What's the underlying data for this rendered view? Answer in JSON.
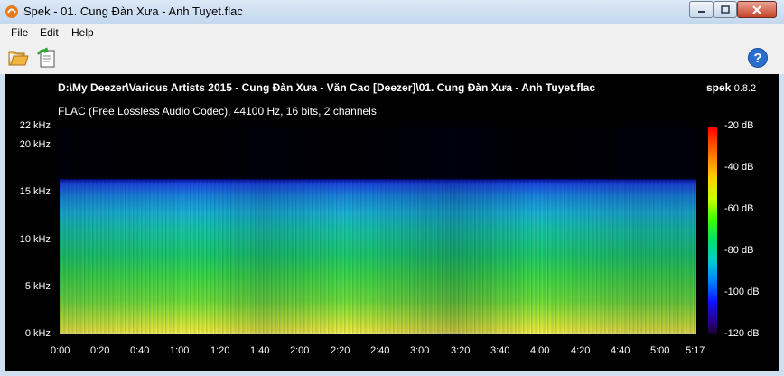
{
  "window": {
    "title": "Spek - 01. Cung Đàn Xưa - Anh Tuyet.flac"
  },
  "menu": {
    "items": [
      "File",
      "Edit",
      "Help"
    ]
  },
  "toolbar": {
    "open_icon": "folder-open-icon",
    "save_icon": "save-export-icon",
    "help_icon": "help-icon"
  },
  "spectrogram": {
    "file_path": "D:\\My Deezer\\Various Artists 2015 - Cung Đàn Xưa - Văn Cao [Deezer]\\01. Cung Đàn Xưa - Anh Tuyet.flac",
    "app_name": "spek",
    "app_version": "0.8.2",
    "file_info": "FLAC (Free Lossless Audio Codec), 44100 Hz, 16 bits, 2 channels",
    "freq_ticks": [
      "22 kHz",
      "20 kHz",
      "15 kHz",
      "10 kHz",
      "5 kHz",
      "0 kHz"
    ],
    "time_ticks": [
      "0:00",
      "0:20",
      "0:40",
      "1:00",
      "1:20",
      "1:40",
      "2:00",
      "2:20",
      "2:40",
      "3:00",
      "3:20",
      "3:40",
      "4:00",
      "4:20",
      "4:40",
      "5:00",
      "5:17"
    ],
    "db_ticks": [
      "-20 dB",
      "-40 dB",
      "-60 dB",
      "-80 dB",
      "-100 dB",
      "-120 dB"
    ]
  }
}
